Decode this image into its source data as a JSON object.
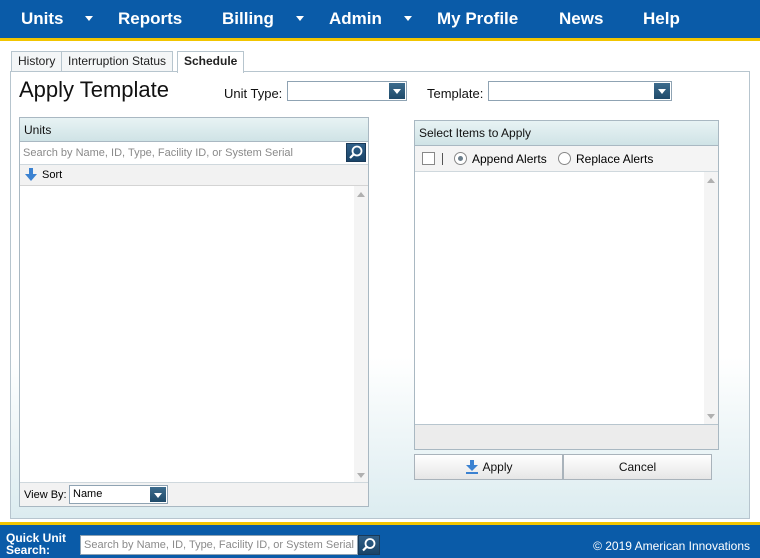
{
  "nav": {
    "items": [
      {
        "label": "Units",
        "has_caret": true
      },
      {
        "label": "Reports",
        "has_caret": false
      },
      {
        "label": "Billing",
        "has_caret": true
      },
      {
        "label": "Admin",
        "has_caret": true
      },
      {
        "label": "My Profile",
        "has_caret": false
      },
      {
        "label": "News",
        "has_caret": false
      },
      {
        "label": "Help",
        "has_caret": false
      }
    ]
  },
  "tabs": [
    {
      "label": "History",
      "active": false
    },
    {
      "label": "Interruption Status",
      "active": false
    },
    {
      "label": "Schedule",
      "active": true
    }
  ],
  "page": {
    "title": "Apply Template",
    "unit_type_label": "Unit Type:",
    "unit_type_value": "",
    "template_label": "Template:",
    "template_value": ""
  },
  "units_panel": {
    "header": "Units",
    "search_placeholder": "Search by Name, ID, Type, Facility ID, or System Serial",
    "sort_label": "Sort",
    "view_by_label": "View By:",
    "view_by_value": "Name"
  },
  "items_panel": {
    "header": "Select Items to Apply",
    "append_label": "Append Alerts",
    "replace_label": "Replace Alerts",
    "selected_mode": "append"
  },
  "buttons": {
    "apply_label": "Apply",
    "cancel_label": "Cancel"
  },
  "footer": {
    "quick_label_line1": "Quick Unit",
    "quick_label_line2": "Search:",
    "search_placeholder": "Search by Name, ID, Type, Facility ID, or System Serial",
    "copyright": "© 2019 American Innovations"
  },
  "colors": {
    "nav_bg": "#0a5ba8",
    "accent_line": "#f2c500",
    "panel_header": "#cfe3e6"
  },
  "icons": {
    "search": "magnifier-icon",
    "sort": "down-arrow-icon",
    "apply": "download-arrow-icon",
    "dropdown": "chevron-down-icon"
  }
}
